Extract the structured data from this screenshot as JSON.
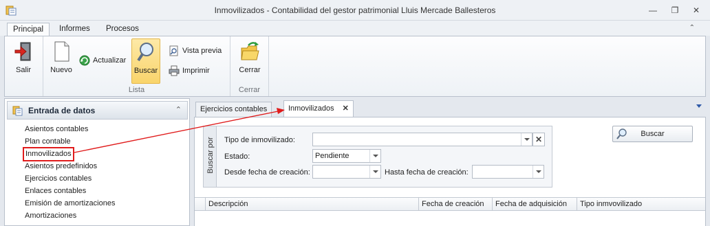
{
  "window": {
    "title": "Inmovilizados - Contabilidad del gestor patrimonial Lluis Mercade Ballesteros",
    "icons": [
      "app-icon",
      "minimize-icon",
      "restore-icon",
      "close-icon"
    ]
  },
  "ribbon": {
    "tabs": [
      {
        "label": "Principal",
        "active": true
      },
      {
        "label": "Informes",
        "active": false
      },
      {
        "label": "Procesos",
        "active": false
      }
    ],
    "groups": {
      "salir": {
        "button": "Salir"
      },
      "lista": {
        "label": "Lista",
        "nuevo": "Nuevo",
        "actualizar": "Actualizar",
        "buscar": "Buscar",
        "vista_previa": "Vista previa",
        "imprimir": "Imprimir"
      },
      "cerrar": {
        "label": "Cerrar",
        "button": "Cerrar"
      }
    }
  },
  "sidebar": {
    "title": "Entrada de datos",
    "items": [
      {
        "label": "Asientos contables"
      },
      {
        "label": "Plan contable"
      },
      {
        "label": "Inmovilizados",
        "selected": true
      },
      {
        "label": "Asientos predefinidos"
      },
      {
        "label": "Ejercicios contables"
      },
      {
        "label": "Enlaces contables"
      },
      {
        "label": "Emisión de amortizaciones"
      },
      {
        "label": "Amortizaciones"
      }
    ]
  },
  "doc_tabs": [
    {
      "label": "Ejercicios contables",
      "active": false
    },
    {
      "label": "Inmovilizados",
      "active": true
    }
  ],
  "search": {
    "side_label": "Buscar por",
    "tipo_label": "Tipo de inmovilizado:",
    "tipo_value": "",
    "estado_label": "Estado:",
    "estado_value": "Pendiente",
    "desde_label": "Desde fecha de creación:",
    "desde_value": "",
    "hasta_label": "Hasta fecha de creación:",
    "hasta_value": "",
    "button": "Buscar"
  },
  "grid": {
    "columns": [
      "Descripción",
      "Fecha de creación",
      "Fecha de adquisición",
      "Tipo inmvovilizado"
    ],
    "rows": []
  },
  "colors": {
    "annotation": "#e01b1b",
    "active_button": "#f9d46b"
  }
}
